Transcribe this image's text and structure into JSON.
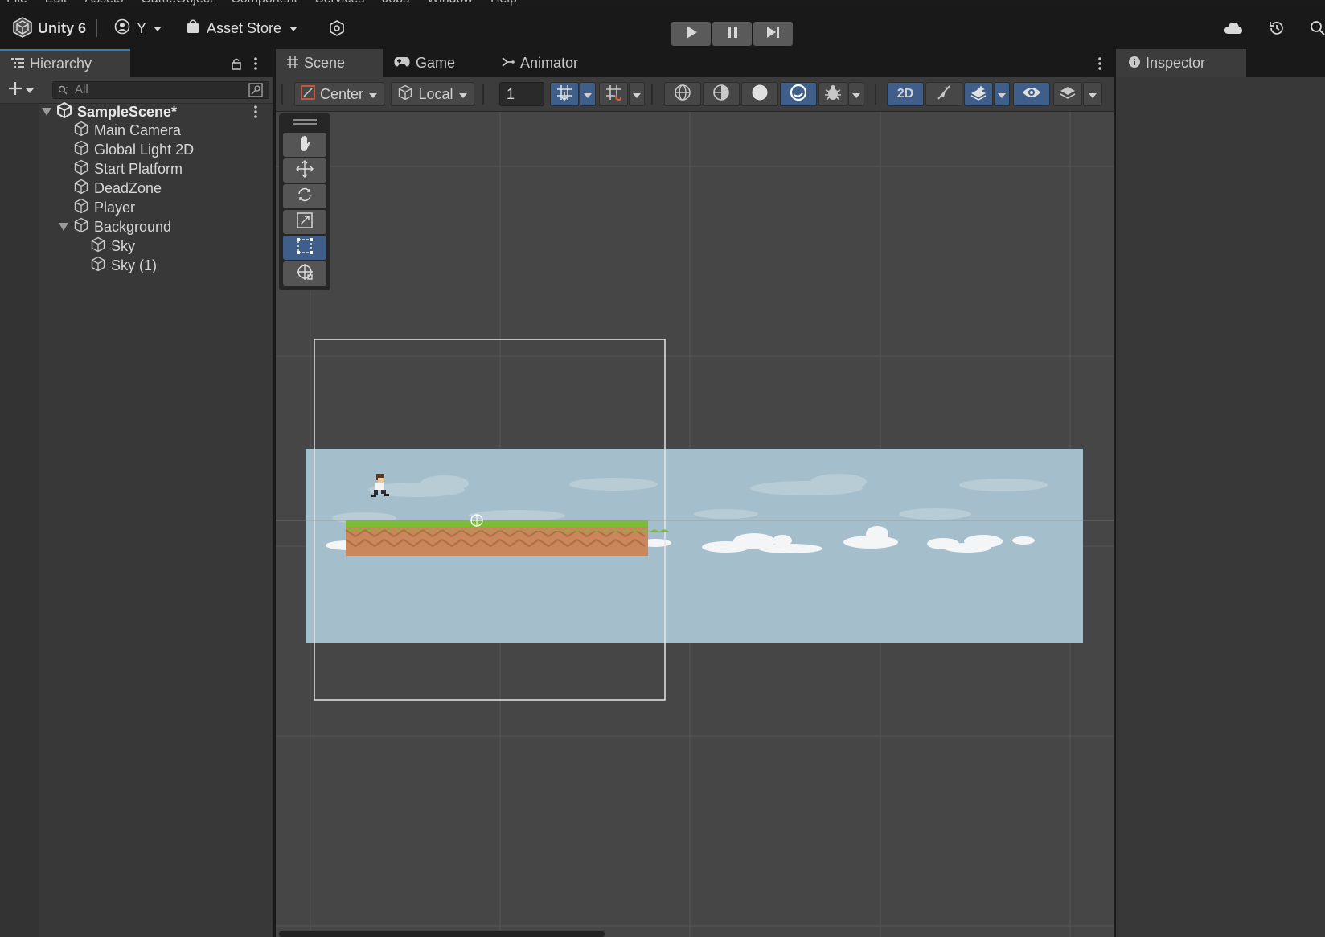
{
  "menu": [
    "File",
    "Edit",
    "Assets",
    "GameObject",
    "Component",
    "Services",
    "Jobs",
    "Window",
    "Help"
  ],
  "topbar": {
    "app_title": "Unity 6",
    "account_label": "Y",
    "asset_store_label": "Asset Store"
  },
  "hierarchy": {
    "tab_label": "Hierarchy",
    "search_placeholder": "All",
    "scene_name": "SampleScene*",
    "items": [
      {
        "label": "Main Camera"
      },
      {
        "label": "Global Light 2D"
      },
      {
        "label": "Start Platform"
      },
      {
        "label": "DeadZone"
      },
      {
        "label": "Player"
      },
      {
        "label": "Background"
      },
      {
        "label": "Sky"
      },
      {
        "label": "Sky (1)"
      }
    ]
  },
  "center_tabs": {
    "scene": "Scene",
    "game": "Game",
    "animator": "Animator"
  },
  "scene_toolbar": {
    "pivot_mode": "Center",
    "pivot_rotation": "Local",
    "grid_increment": "1",
    "mode_2d": "2D"
  },
  "inspector": {
    "tab_label": "Inspector"
  },
  "colors": {
    "accent_blue": "#3a79bb",
    "toggle_on": "#3f5f8a",
    "sky": "#a4bfcb",
    "grass": "#7cbc34",
    "dirt": "#c9875b"
  }
}
